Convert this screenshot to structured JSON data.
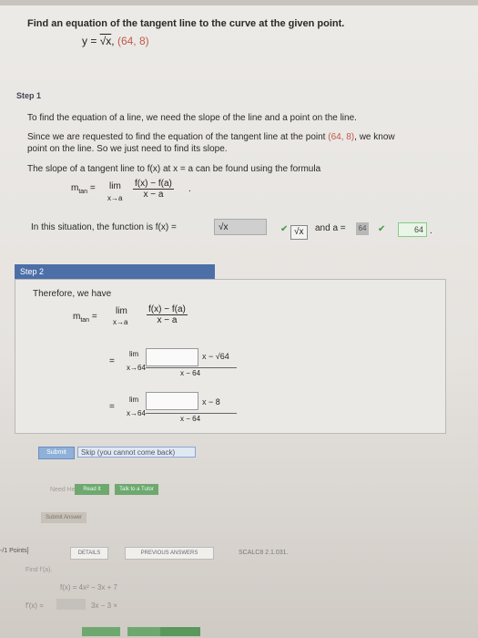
{
  "problem": {
    "prompt": "Find an equation of the tangent line to the curve at the given point.",
    "equation_left": "y = ",
    "equation_rad": "√x",
    "equation_sep": ", ",
    "point": "(64, 8)"
  },
  "step1": {
    "label": "Step 1",
    "line1": "To find the equation of a line, we need the slope of the line and a point on the line.",
    "line2a": "Since we are requested to find the equation of the tangent line at the point ",
    "line2_point": "(64, 8)",
    "line2b": ", we know",
    "line3": "point on the line. So we just need to find its slope.",
    "line4": "The slope of a tangent line to f(x) at x = a can be found using the formula",
    "m_tan": "m",
    "m_sub": "tan",
    "equals": "=",
    "lim": "lim",
    "lim_sub": "x→a",
    "numerator": "f(x) − f(a)",
    "denominator": "x − a",
    "period": ".",
    "situation": "In this situation, the function is f(x) =",
    "fn_value": "√x",
    "fn_answer": "√x",
    "and_a": "and a =",
    "a_value": "64",
    "a_answer": "64",
    "trailing_period": "."
  },
  "step2": {
    "label": "Step 2",
    "therefore": "Therefore, we have",
    "m_tan": "m",
    "m_sub": "tan",
    "equals": "=",
    "lim": "lim",
    "lim_sub_a": "x→a",
    "numerator_a": "f(x) − f(a)",
    "denominator_a": "x − a",
    "lim_sub_64": "x→64",
    "minus_sqrt": "− √64",
    "minus_8": "− 8",
    "denominator_64": "x − 64"
  },
  "buttons": {
    "submit": "Submit",
    "skip": "Skip (you cannot come back)",
    "need_help": "Need Help?",
    "read_it": "Read It",
    "talk_to_tutor": "Talk to a Tutor",
    "submit_answer": "Submit Answer"
  },
  "next_problem": {
    "points": "-/1 Points]",
    "details": "DETAILS",
    "previous_answers": "PREVIOUS ANSWERS",
    "code": "SCALC8 2.1.031.",
    "find": "Find f'(a).",
    "fx": "f(x) = 4x² − 3x + 7",
    "fpx": "f'(x) =",
    "fpx_tail": "3x − 3 ×"
  },
  "colors": {
    "accent": "#4d6fa8",
    "point_red": "#c05a4a",
    "check_green": "#3c9a3c"
  }
}
